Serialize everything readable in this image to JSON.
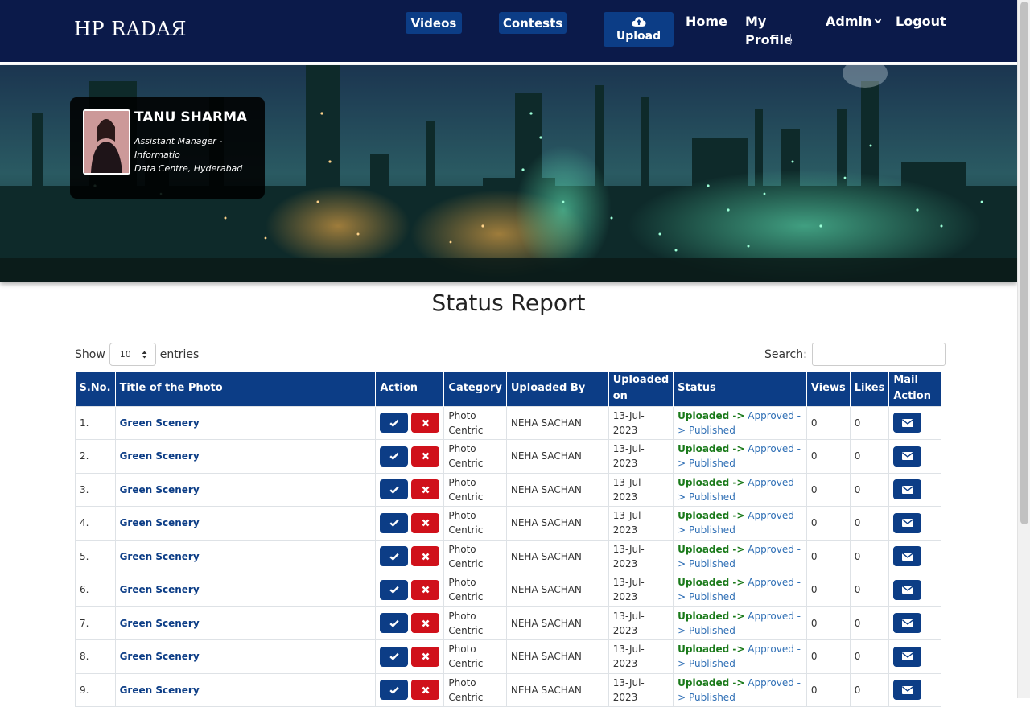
{
  "nav": {
    "brand": "HP RADAЯ",
    "videos": "Videos",
    "contests": "Contests",
    "upload": "Upload",
    "home": "Home",
    "my_profile": "My Profile",
    "admin": "Admin",
    "logout": "Logout"
  },
  "profile": {
    "name": "TANU SHARMA",
    "designation": "Assistant Manager - Informatio",
    "location": "Data Centre, Hyderabad"
  },
  "page": {
    "title": "Status Report"
  },
  "controls": {
    "show_label": "Show",
    "entries_value": "10",
    "entries_label": "entries",
    "search_label": "Search:"
  },
  "table": {
    "headers": [
      "S.No.",
      "Title of the Photo",
      "Action",
      "Category",
      "Uploaded By",
      "Uploaded on",
      "Status",
      "Views",
      "Likes",
      "Mail Action"
    ],
    "status_parts": [
      "Uploaded ->",
      "Approved ->",
      "Published"
    ],
    "rows": [
      {
        "sno": "1.",
        "title": "Green Scenery",
        "category": "Photo Centric",
        "uploaded_by": "NEHA SACHAN",
        "uploaded_on": "13-Jul-2023",
        "views": "0",
        "likes": "0"
      },
      {
        "sno": "2.",
        "title": "Green Scenery",
        "category": "Photo Centric",
        "uploaded_by": "NEHA SACHAN",
        "uploaded_on": "13-Jul-2023",
        "views": "0",
        "likes": "0"
      },
      {
        "sno": "3.",
        "title": "Green Scenery",
        "category": "Photo Centric",
        "uploaded_by": "NEHA SACHAN",
        "uploaded_on": "13-Jul-2023",
        "views": "0",
        "likes": "0"
      },
      {
        "sno": "4.",
        "title": "Green Scenery",
        "category": "Photo Centric",
        "uploaded_by": "NEHA SACHAN",
        "uploaded_on": "13-Jul-2023",
        "views": "0",
        "likes": "0"
      },
      {
        "sno": "5.",
        "title": "Green Scenery",
        "category": "Photo Centric",
        "uploaded_by": "NEHA SACHAN",
        "uploaded_on": "13-Jul-2023",
        "views": "0",
        "likes": "0"
      },
      {
        "sno": "6.",
        "title": "Green Scenery",
        "category": "Photo Centric",
        "uploaded_by": "NEHA SACHAN",
        "uploaded_on": "13-Jul-2023",
        "views": "0",
        "likes": "0"
      },
      {
        "sno": "7.",
        "title": "Green Scenery",
        "category": "Photo Centric",
        "uploaded_by": "NEHA SACHAN",
        "uploaded_on": "13-Jul-2023",
        "views": "0",
        "likes": "0"
      },
      {
        "sno": "8.",
        "title": "Green Scenery",
        "category": "Photo Centric",
        "uploaded_by": "NEHA SACHAN",
        "uploaded_on": "13-Jul-2023",
        "views": "0",
        "likes": "0"
      },
      {
        "sno": "9.",
        "title": "Green Scenery",
        "category": "Photo Centric",
        "uploaded_by": "NEHA SACHAN",
        "uploaded_on": "13-Jul-2023",
        "views": "0",
        "likes": "0"
      }
    ]
  },
  "icons": {
    "upload": "cloud-upload-icon",
    "approve": "check-icon",
    "reject": "times-icon",
    "mail": "envelope-icon",
    "admin_dropdown": "chevron-down-icon"
  },
  "colors": {
    "navbar": "#0b1a4a",
    "primary": "#0c3d86",
    "danger": "#d0111b",
    "uploaded_status": "#1a7a1a",
    "approved_status": "#2f6fb5"
  }
}
